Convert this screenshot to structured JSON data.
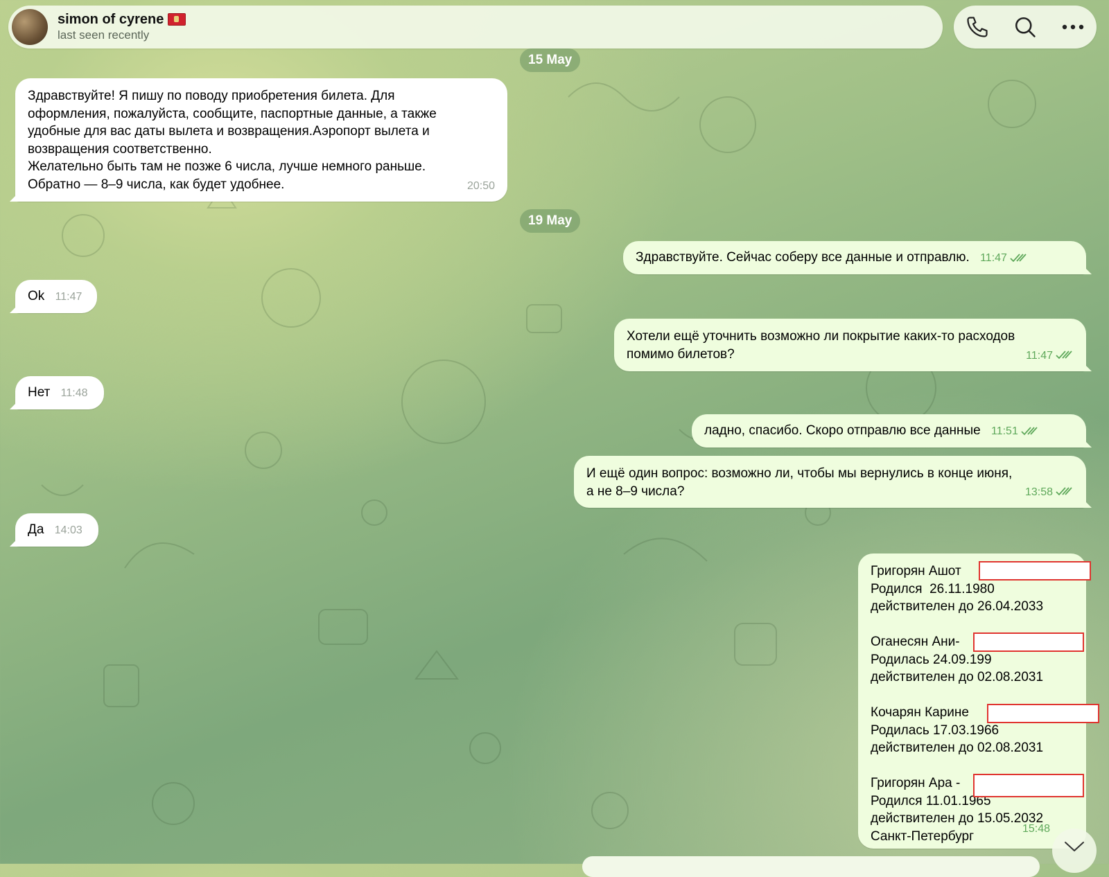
{
  "header": {
    "name": "simon of cyrene",
    "status": "last seen recently"
  },
  "icons": {
    "call": "phone-icon",
    "search": "search-icon",
    "more": "more-icon"
  },
  "colors": {
    "incoming_bubble": "#ffffff",
    "outgoing_bubble": "#effdde",
    "outgoing_time": "#5ea85a",
    "redaction": "#e0342f"
  },
  "dates": {
    "d1": "15 May",
    "d2": "19 May"
  },
  "messages": {
    "m1": {
      "lines": [
        "Здравствуйте! Я пишу по поводу приобретения билета. Для",
        "оформления, пожалуйста, сообщите, паспортные данные, а также",
        "удобные для вас даты вылета и возвращения.Аэропорт вылета и",
        "возвращения соответственно.",
        "Желательно быть там не позже 6 числа, лучше немного раньше.",
        "Обратно — 8–9 числа, как будет удобнее."
      ],
      "time": "20:50"
    },
    "m2": {
      "text": "Здравствуйте. Сейчас соберу все данные и отправлю.",
      "time": "11:47"
    },
    "m3": {
      "text": "Ok",
      "time": "11:47"
    },
    "m4": {
      "lines": [
        "Хотели ещё уточнить возможно ли покрытие каких-то расходов",
        "помимо билетов?"
      ],
      "time": "11:47"
    },
    "m5": {
      "text": "Нет",
      "time": "11:48"
    },
    "m6": {
      "text": "ладно, спасибо. Скоро отправлю все данные",
      "time": "11:51"
    },
    "m7": {
      "lines": [
        "И ещё один вопрос: возможно ли, чтобы мы вернулись в конце июня,",
        "а не 8–9 числа?"
      ],
      "time": "13:58"
    },
    "m8": {
      "text": "Да",
      "time": "14:03"
    },
    "m9": {
      "lines": [
        "Григорян Ашот",
        "Родился  26.11.1980",
        "действителен до 26.04.2033",
        "",
        "Оганесян Ани-",
        "Родилась 24.09.199",
        "действителен до 02.08.2031",
        "",
        "Кочарян Карине",
        "Родилась 17.03.1966",
        "действителен до 02.08.2031",
        "",
        "Григорян Ара -",
        "Родился 11.01.1965",
        "действителен до 15.05.2032",
        "Санкт-Петербург"
      ],
      "time": "15:48"
    }
  }
}
